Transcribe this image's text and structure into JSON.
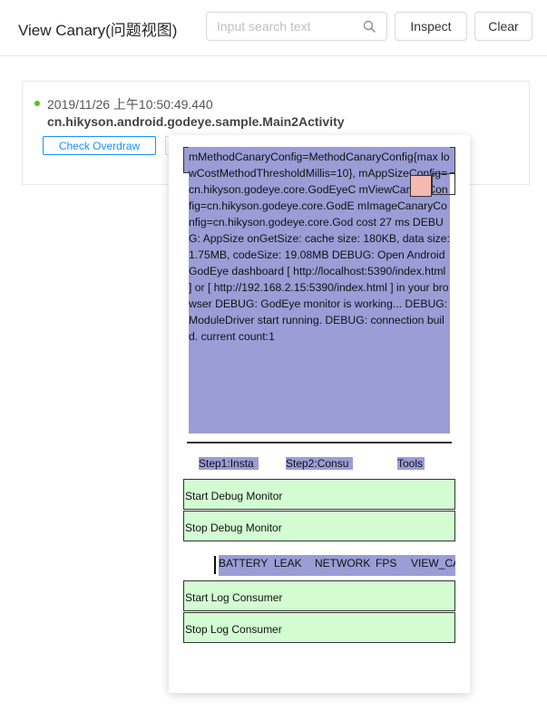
{
  "header": {
    "title": "View Canary(问题视图)",
    "search_placeholder": "Input search text",
    "inspect_label": "Inspect",
    "clear_label": "Clear"
  },
  "record": {
    "timestamp": "2019/11/26 上午10:50:49.440",
    "activity": "cn.hikyson.android.godeye.sample.Main2Activity",
    "check_overdraw_label": "Check Overdraw",
    "status_color": "#52c41a"
  },
  "preview": {
    "log_text": "mMethodCanaryConfig=MethodCanaryConfig{max lowCostMethodThresholdMillis=10}, mAppSizeConfig=cn.hikyson.godeye.core.GodEyeC mViewCanaryConfig=cn.hikyson.godeye.core.GodE mImageCanaryConfig=cn.hikyson.godeye.core.God cost 27 ms DEBUG: AppSize onGetSize: cache size: 180KB, data size: 1.75MB, codeSize: 19.08MB DEBUG: Open AndroidGodEye dashboard [ http://localhost:5390/index.html ] or [ http://192.168.2.15:5390/index.html ] in your browser DEBUG: GodEye monitor is working... DEBUG: ModuleDriver start running. DEBUG: connection build. current count:1",
    "tabs": [
      "Step1:Insta",
      "Step2:Consu",
      "Tools"
    ],
    "start_debug_label": "Start Debug Monitor",
    "stop_debug_label": "Stop Debug Monitor",
    "modules": [
      "BATTERY",
      "LEAK",
      "NETWORK",
      "FPS",
      "VIEW_CA"
    ],
    "start_log_label": "Start Log Consumer",
    "stop_log_label": "Stop Log Consumer",
    "colors": {
      "text_view": "#9a9dd6",
      "button": "#d3fcd3",
      "highlight": "#f4b9b0"
    }
  }
}
